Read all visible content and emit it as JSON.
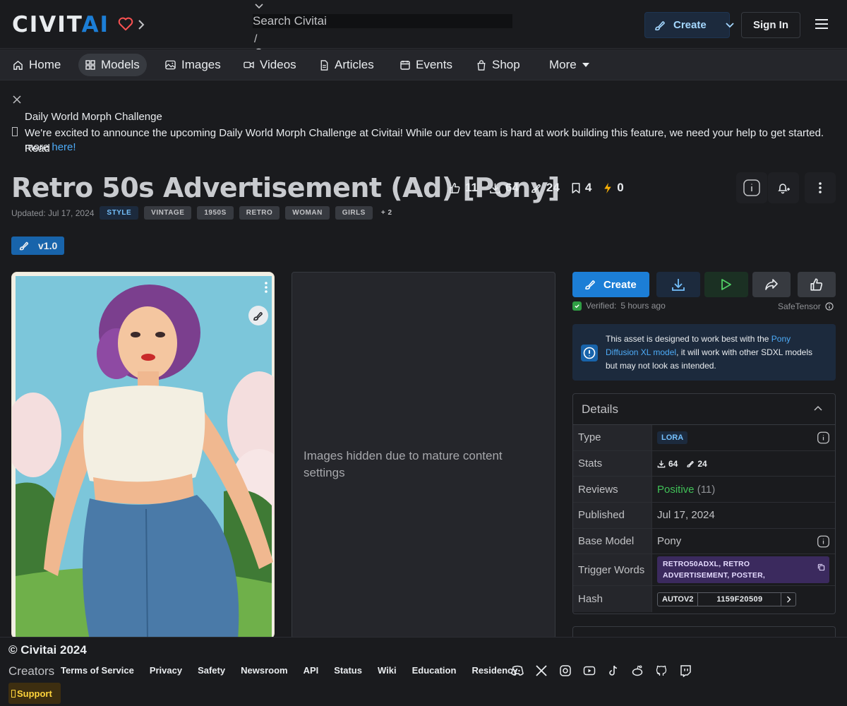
{
  "header": {
    "logo_main": "CIVIT",
    "logo_accent": "AI",
    "search_placeholder": "Search Civitai",
    "search_hotkey": "/",
    "create_label": "Create",
    "signin_label": "Sign In"
  },
  "nav": {
    "items": [
      {
        "label": "Home",
        "icon": "home-icon"
      },
      {
        "label": "Models",
        "icon": "grid-icon",
        "active": true
      },
      {
        "label": "Images",
        "icon": "photo-icon"
      },
      {
        "label": "Videos",
        "icon": "video-icon"
      },
      {
        "label": "Articles",
        "icon": "article-icon"
      },
      {
        "label": "Events",
        "icon": "calendar-icon"
      },
      {
        "label": "Shop",
        "icon": "shopping-bag-icon"
      },
      {
        "label": "More",
        "icon": "caret-down-icon"
      }
    ]
  },
  "announcement": {
    "title": "Daily World Morph Challenge",
    "body": "We're excited to announce the upcoming Daily World Morph Challenge at Civitai! While our dev team is hard at work building this feature, we need your help to get started. Read",
    "body_end": "more",
    "link": "here!"
  },
  "model": {
    "title": "Retro 50s Advertisement (Ad) [Pony]",
    "stats": {
      "likes": "11",
      "downloads": "64",
      "generations": "24",
      "collected": "4",
      "buzz": "0"
    },
    "updated": "Updated: Jul 17, 2024",
    "tags": [
      "STYLE",
      "VINTAGE",
      "1950S",
      "RETRO",
      "WOMAN",
      "GIRLS"
    ],
    "more_tags": "+ 2",
    "version": "v1.0"
  },
  "gallery": {
    "hidden_text": "Images hidden due to mature content settings"
  },
  "actions": {
    "create_label": "Create",
    "verified_label": "Verified:",
    "verified_time": "5 hours ago",
    "format": "SafeTensor"
  },
  "alert": {
    "text_before": "This asset is designed to work best with the",
    "link": "Pony Diffusion XL model",
    "text_after": ", it will work with other SDXL models but may not look as intended."
  },
  "details": {
    "heading": "Details",
    "type_label": "Type",
    "type_value": "LORA",
    "stats_label": "Stats",
    "stats_downloads": "64",
    "stats_generations": "24",
    "reviews_label": "Reviews",
    "reviews_sentiment": "Positive",
    "reviews_count": "(11)",
    "published_label": "Published",
    "published_value": "Jul 17, 2024",
    "base_label": "Base Model",
    "base_value": "Pony",
    "trigger_label": "Trigger Words",
    "trigger_value": "RETRO50ADXL, RETRO ADVERTISEMENT, POSTER,",
    "hash_label": "Hash",
    "hash_type": "AUTOV2",
    "hash_value": "1159F20509"
  },
  "footer": {
    "copyright": "© Civitai 2024",
    "creators": "Creators",
    "links": [
      "Terms of Service",
      "Privacy",
      "Safety",
      "Newsroom",
      "API",
      "Status",
      "Wiki",
      "Education",
      "Residency"
    ],
    "support": "Support",
    "socials": [
      "discord-icon",
      "x-icon",
      "instagram-icon",
      "youtube-icon",
      "tiktok-icon",
      "reddit-icon",
      "github-icon",
      "twitch-icon"
    ]
  },
  "colors": {
    "accent": "#1c7ed6",
    "positive": "#40c057",
    "trigger_bg": "#3b2a5e"
  }
}
